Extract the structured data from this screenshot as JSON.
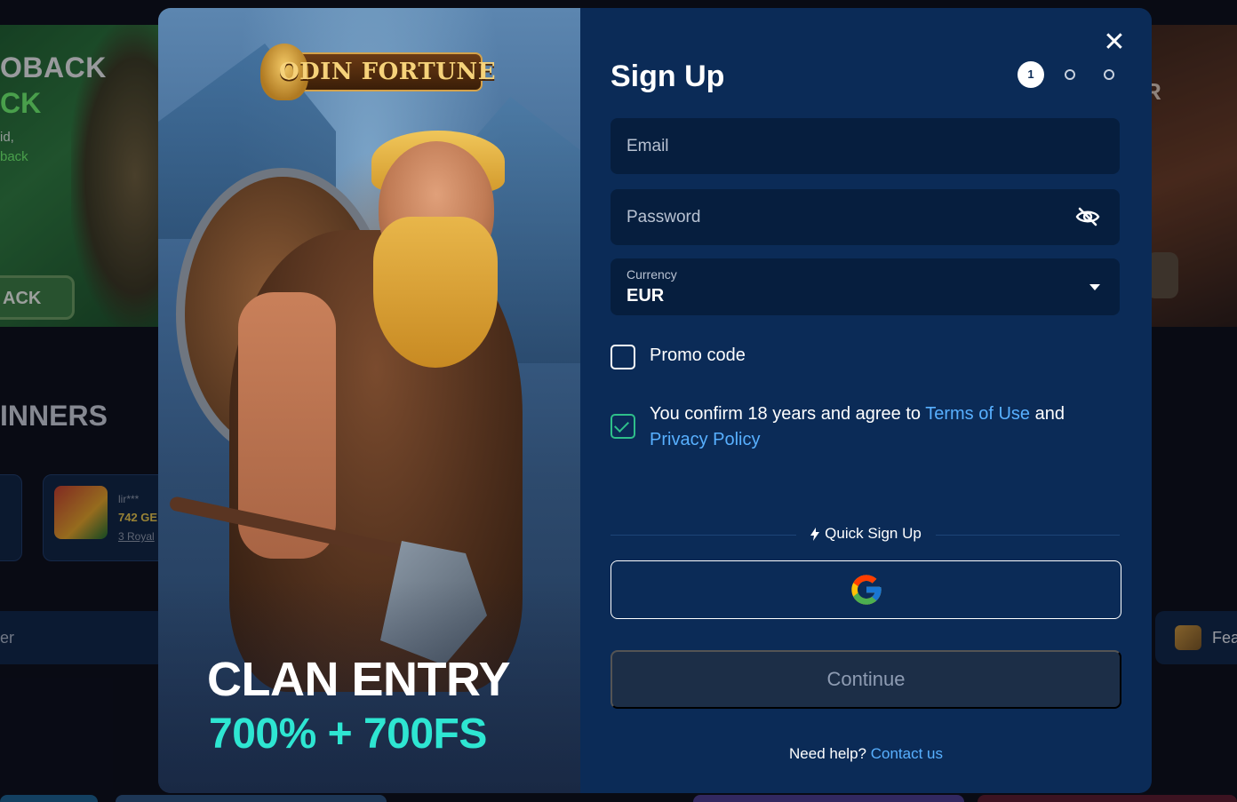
{
  "background": {
    "promo_left": {
      "line1": "OBACK",
      "line2": "CK",
      "line3": "id,",
      "line4": "back",
      "button": "ACK"
    },
    "winners_heading": "INNERS",
    "winner_card": {
      "user": "lir***",
      "amount": "742 GE",
      "game": "3 Royal"
    },
    "left_bar_text": "er",
    "promo_right_text": "R",
    "right_bar_text": "Fea",
    "colors": {
      "page_bg": "#0b0d16"
    }
  },
  "modal": {
    "art": {
      "logo_text": "ODIN FORTUNE",
      "headline": "CLAN ENTRY",
      "offer": "700% + 700FS",
      "offer_color": "#2ee6d2"
    },
    "form": {
      "close_icon": "close-icon",
      "title": "Sign Up",
      "steps": {
        "current": "1",
        "total": 3
      },
      "email": {
        "placeholder": "Email",
        "value": ""
      },
      "password": {
        "placeholder": "Password",
        "value": "",
        "toggle_icon": "eye-off-icon"
      },
      "currency": {
        "label": "Currency",
        "value": "EUR"
      },
      "promo_code": {
        "label": "Promo code",
        "checked": false
      },
      "terms": {
        "checked": true,
        "text_before": "You confirm 18 years and agree to ",
        "terms_link": "Terms of Use",
        "text_middle": " and",
        "privacy_link": "Privacy Policy"
      },
      "quick_signup": "Quick Sign Up",
      "google_button_icon": "google-icon",
      "continue_button": "Continue",
      "help": {
        "text": "Need help?",
        "link": "Contact us"
      },
      "colors": {
        "panel_bg": "#0b2b57",
        "field_bg": "#061e3e",
        "link": "#58b0ff",
        "check": "#2fbf8a"
      }
    }
  }
}
